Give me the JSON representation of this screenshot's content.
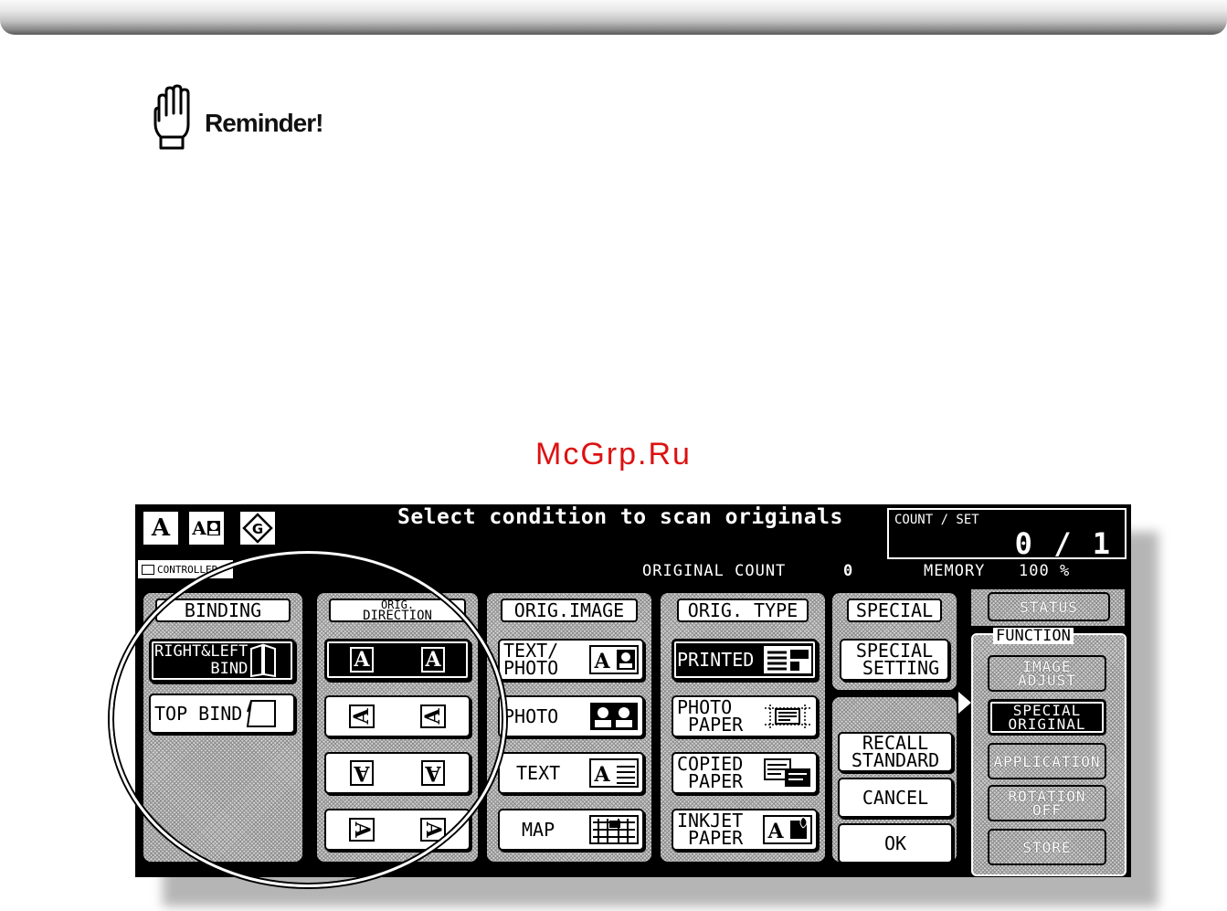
{
  "reminder": {
    "label": "Reminder!",
    "icon": "hand-stop-icon"
  },
  "watermark": "McGrp.Ru",
  "screen": {
    "title": "Select condition to scan originals",
    "header_icons": [
      {
        "name": "text-mode-icon",
        "glyph": "A"
      },
      {
        "name": "text-photo-mode-icon",
        "glyph": "A"
      },
      {
        "name": "auto-mode-icon",
        "glyph": "G"
      }
    ],
    "count_set": {
      "label": "COUNT / SET",
      "value": "0 / 1"
    },
    "controller": "CONTROLLER",
    "original_count": {
      "label": "ORIGINAL COUNT",
      "value": "0"
    },
    "memory": {
      "label": "MEMORY",
      "value": "100 %"
    },
    "binding": {
      "header": "BINDING",
      "right_left_line1": "RIGHT&LEFT",
      "right_left_line2": "BIND",
      "top_bind": "TOP BIND"
    },
    "orig_direction": {
      "header_line1": "ORIG.",
      "header_line2": "DIRECTION",
      "glyph": "A"
    },
    "orig_image": {
      "header": "ORIG.IMAGE",
      "text_photo_line1": "TEXT/",
      "text_photo_line2": "PHOTO",
      "photo": "PHOTO",
      "text": "TEXT",
      "map": "MAP"
    },
    "orig_type": {
      "header": "ORIG. TYPE",
      "printed": "PRINTED",
      "photo_paper_line1": "PHOTO",
      "photo_paper_line2": "PAPER",
      "copied_paper_line1": "COPIED",
      "copied_paper_line2": "PAPER",
      "inkjet_paper_line1": "INKJET",
      "inkjet_paper_line2": "PAPER"
    },
    "special": {
      "header": "SPECIAL",
      "setting_line1": "SPECIAL",
      "setting_line2": "SETTING",
      "recall_line1": "RECALL",
      "recall_line2": "STANDARD",
      "cancel": "CANCEL",
      "ok": "OK"
    },
    "status": "STATUS",
    "function": {
      "label": "FUNCTION",
      "image_adjust_line1": "IMAGE",
      "image_adjust_line2": "ADJUST",
      "special_original_line1": "SPECIAL",
      "special_original_line2": "ORIGINAL",
      "application": "APPLICATION",
      "rotation_off_line1": "ROTATION",
      "rotation_off_line2": "OFF",
      "store": "STORE"
    }
  }
}
